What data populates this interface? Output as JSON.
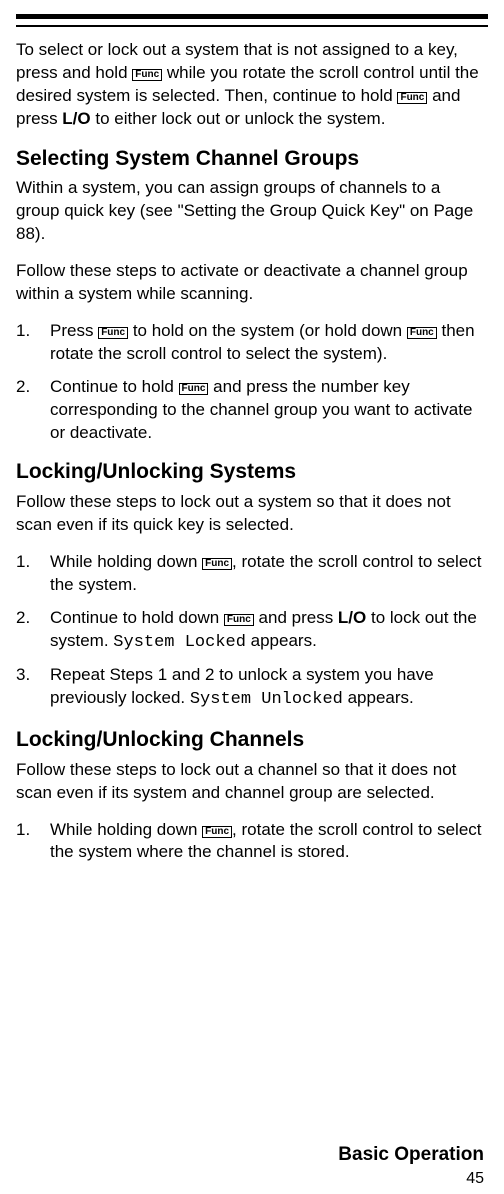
{
  "func_label": "Func",
  "intro_a": "To select or lock out a system that is not assigned to a key, press and hold ",
  "intro_b": " while you rotate the scroll control until the desired system is selected. Then, continue to hold ",
  "intro_c": " and press ",
  "intro_lo": "L/O",
  "intro_d": " to either lock out or unlock the system.",
  "heading1": "Selecting System Channel Groups",
  "p1": "Within a system, you can assign groups of channels to a group quick key (see \"Setting the Group Quick Key\" on Page 88).",
  "p2": "Follow these steps to activate or deactivate a channel group within a system while scanning.",
  "list1": {
    "i1_num": "1.",
    "i1_a": "Press ",
    "i1_b": " to hold on the system (or hold down ",
    "i1_c": " then rotate the scroll control to select the system).",
    "i2_num": "2.",
    "i2_a": "Continue to hold ",
    "i2_b": " and press the number key corresponding to the channel group you want to activate or deactivate."
  },
  "heading2": "Locking/Unlocking Systems",
  "p3": "Follow these steps to lock out a system so that it does not scan even if its quick key is selected.",
  "list2": {
    "i1_num": "1.",
    "i1_a": "While holding down ",
    "i1_b": ", rotate the scroll control to select the system.",
    "i2_num": "2.",
    "i2_a": "Continue to hold down ",
    "i2_b": " and press ",
    "i2_lo": "L/O",
    "i2_c": " to lock out the system. ",
    "i2_code": "System Locked",
    "i2_d": " appears.",
    "i3_num": "3.",
    "i3_a": "Repeat Steps 1 and 2 to unlock a system you have previously locked. ",
    "i3_code": "System Unlocked",
    "i3_b": " appears."
  },
  "heading3": "Locking/Unlocking Channels",
  "p4": "Follow these steps to lock out a channel so that it does not scan even if its system and channel group are selected.",
  "list3": {
    "i1_num": "1.",
    "i1_a": "While holding down ",
    "i1_b": ", rotate the scroll control to select the system where the channel is stored."
  },
  "footer": "Basic Operation",
  "page_num": "45"
}
